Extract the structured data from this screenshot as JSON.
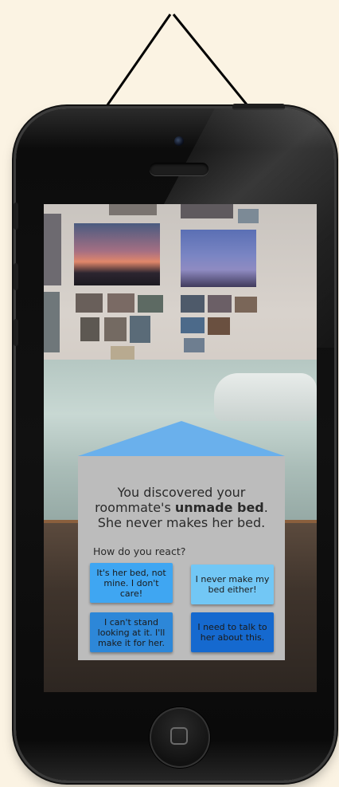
{
  "scenario": {
    "prompt_line1": "You discovered your",
    "prompt_line2_pre": "roommate's ",
    "prompt_line2_bold": "unmade bed",
    "prompt_line2_post": ".",
    "prompt_line3": "She never makes her bed.",
    "question": "How do you react?",
    "choices": [
      "It's her bed, not mine. I don't care!",
      "I never make my bed either!",
      "I can't stand looking at it. I'll make it for her.",
      "I need to talk to her about this."
    ]
  },
  "colors": {
    "background": "#fbf3e3",
    "card": "#bcbcbc",
    "choice_1": "#3fa6f2",
    "choice_2": "#72c7f5",
    "choice_3": "#2d87d8",
    "choice_4": "#1569cf"
  }
}
